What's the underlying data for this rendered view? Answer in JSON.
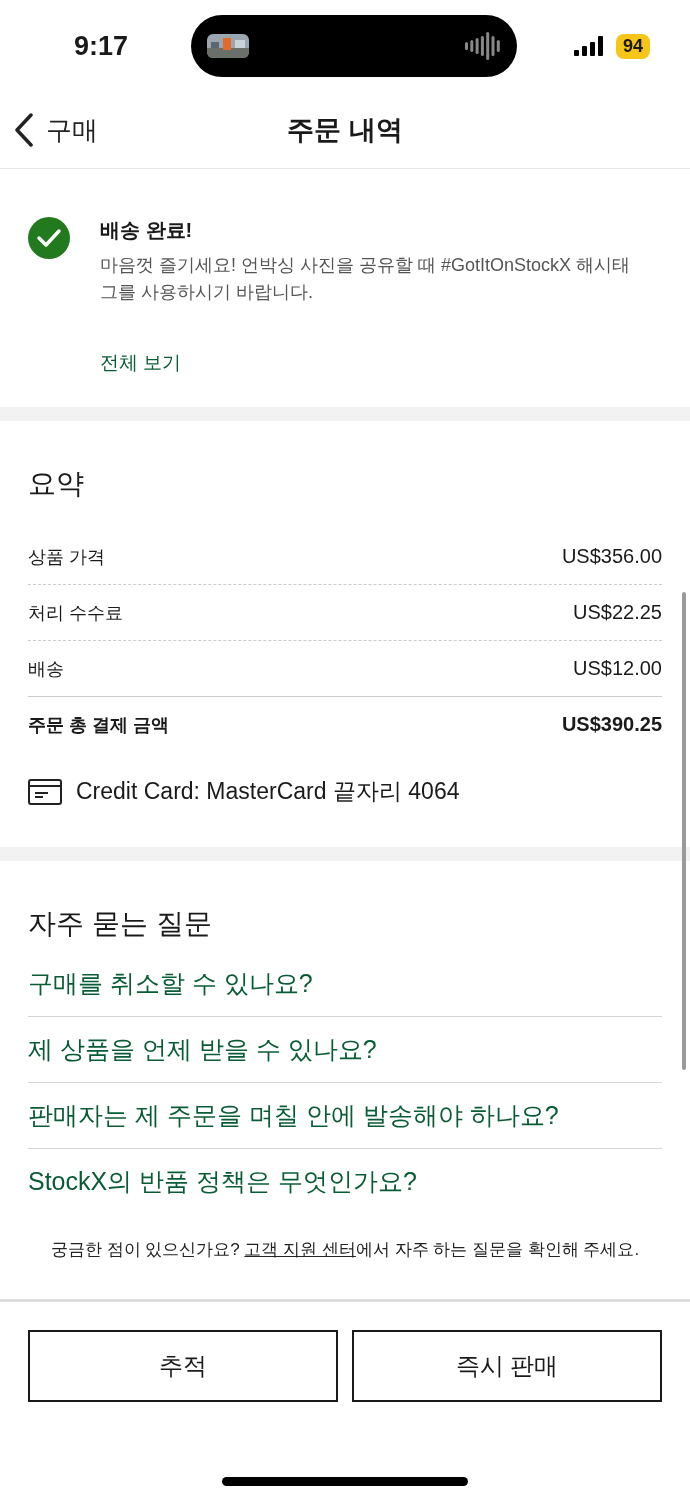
{
  "status_bar": {
    "time": "9:17",
    "battery": "94"
  },
  "nav": {
    "back": "구매",
    "title": "주문 내역"
  },
  "order_status": {
    "title": "배송 완료!",
    "message": "마음껏 즐기세요! 언박싱 사진을 공유할 때 #GotItOnStockX 해시태그를 사용하시기 바랍니다.",
    "link": "전체 보기"
  },
  "summary": {
    "title": "요약",
    "rows": [
      {
        "label": "상품 가격",
        "value": "US$356.00",
        "kind": "item"
      },
      {
        "label": "처리 수수료",
        "value": "US$22.25",
        "kind": "item"
      },
      {
        "label": "배송",
        "value": "US$12.00",
        "kind": "item"
      },
      {
        "label": "주문 총 결제 금액",
        "value": "US$390.25",
        "kind": "total"
      }
    ],
    "payment": "Credit Card: MasterCard 끝자리 4064"
  },
  "faq": {
    "title": "자주 묻는 질문",
    "items": [
      "구매를 취소할 수 있나요?",
      "제 상품을 언제 받을 수 있나요?",
      "판매자는 제 주문을 며칠 안에 발송해야 하나요?",
      "StockX의 반품 정책은 무엇인가요?"
    ],
    "help": {
      "before": "궁금한 점이 있으신가요? ",
      "link": "고객 지원 센터",
      "after": "에서 자주 하는 질문을 확인해 주세요."
    }
  },
  "buttons": [
    "추적",
    "즉시 판매"
  ]
}
